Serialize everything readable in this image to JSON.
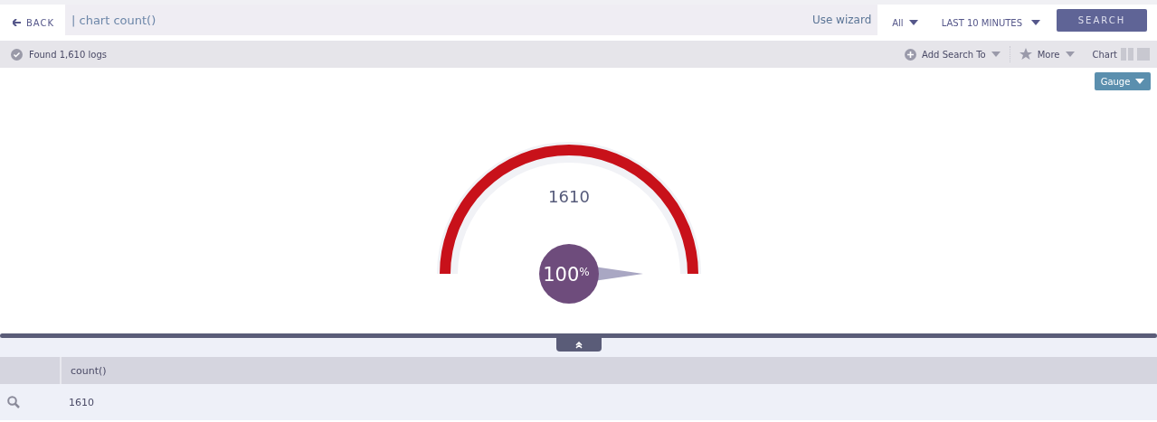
{
  "top_bar": {
    "back": "BACK",
    "query": "| chart count()",
    "wizard": "Use wizard",
    "scope": "All",
    "time_range": "LAST 10 MINUTES",
    "search": "SEARCH"
  },
  "toolbar": {
    "status": "Found 1,610 logs",
    "add_search": "Add Search To",
    "more": "More",
    "chart_label": "Chart"
  },
  "chart": {
    "type_button": "Gauge",
    "gauge": {
      "value": "1610",
      "percent": "100",
      "unit": "%"
    }
  },
  "table": {
    "columns": [
      "count()"
    ],
    "rows": [
      {
        "cells": [
          "1610"
        ]
      }
    ]
  }
}
